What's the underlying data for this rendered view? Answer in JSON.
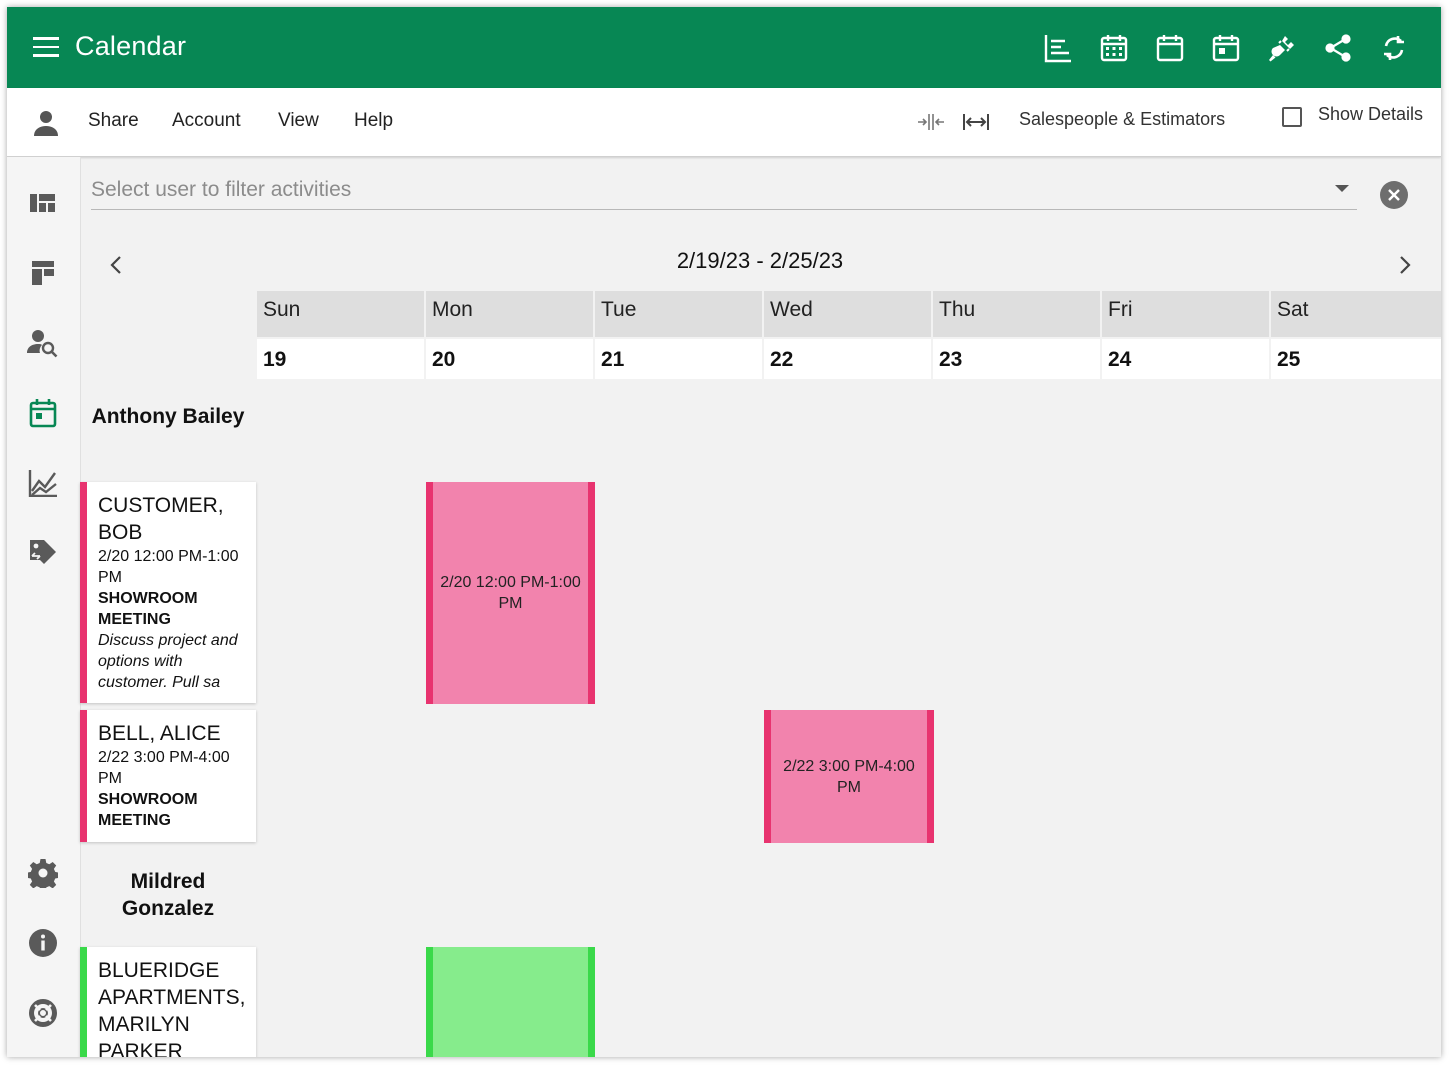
{
  "app": {
    "title": "Calendar"
  },
  "toolbar": {
    "menu": [
      "Share",
      "Account",
      "View",
      "Help"
    ],
    "group_select": "Salespeople & Estimators",
    "show_details_label": "Show Details",
    "show_details_checked": false
  },
  "filter": {
    "placeholder": "Select user to filter activities"
  },
  "calendar": {
    "range": "2/19/23 - 2/25/23",
    "days": [
      {
        "name": "Sun",
        "num": "19"
      },
      {
        "name": "Mon",
        "num": "20"
      },
      {
        "name": "Tue",
        "num": "21"
      },
      {
        "name": "Wed",
        "num": "22"
      },
      {
        "name": "Thu",
        "num": "23"
      },
      {
        "name": "Fri",
        "num": "24"
      },
      {
        "name": "Sat",
        "num": "25"
      }
    ]
  },
  "people": [
    {
      "name": "Anthony Bailey",
      "activities": [
        {
          "customer": "CUSTOMER, BOB",
          "time": "2/20 12:00 PM-1:00 PM",
          "type": "SHOWROOM MEETING",
          "desc": "Discuss project and options with customer. Pull sa",
          "event_text": "2/20 12:00 PM-1:00 PM",
          "color": "#f283ad",
          "accent": "#e8336f"
        },
        {
          "customer": "BELL, ALICE",
          "time": "2/22 3:00 PM-4:00 PM",
          "type": "SHOWROOM MEETING",
          "desc": "",
          "event_text": "2/22 3:00 PM-4:00 PM",
          "color": "#f283ad",
          "accent": "#e8336f"
        }
      ]
    },
    {
      "name": "Mildred Gonzalez",
      "activities": [
        {
          "customer": "BLUERIDGE APARTMENTS, MARILYN PARKER",
          "time": "",
          "type": "",
          "desc": "",
          "event_text": "",
          "color": "#86ec8c",
          "accent": "#3ad94a"
        }
      ]
    }
  ],
  "colors": {
    "brand": "#078754",
    "active_nav": "#078754"
  },
  "icons": {
    "top": [
      "gantt-view-icon",
      "month-view-icon",
      "week-view-icon",
      "day-view-icon",
      "plug-icon",
      "share-icon",
      "sync-icon"
    ],
    "sidebar": [
      "dashboard-icon",
      "board-icon",
      "user-search-icon",
      "calendar-icon",
      "chart-icon",
      "tag-icon",
      "settings-icon",
      "info-icon",
      "support-icon"
    ]
  }
}
